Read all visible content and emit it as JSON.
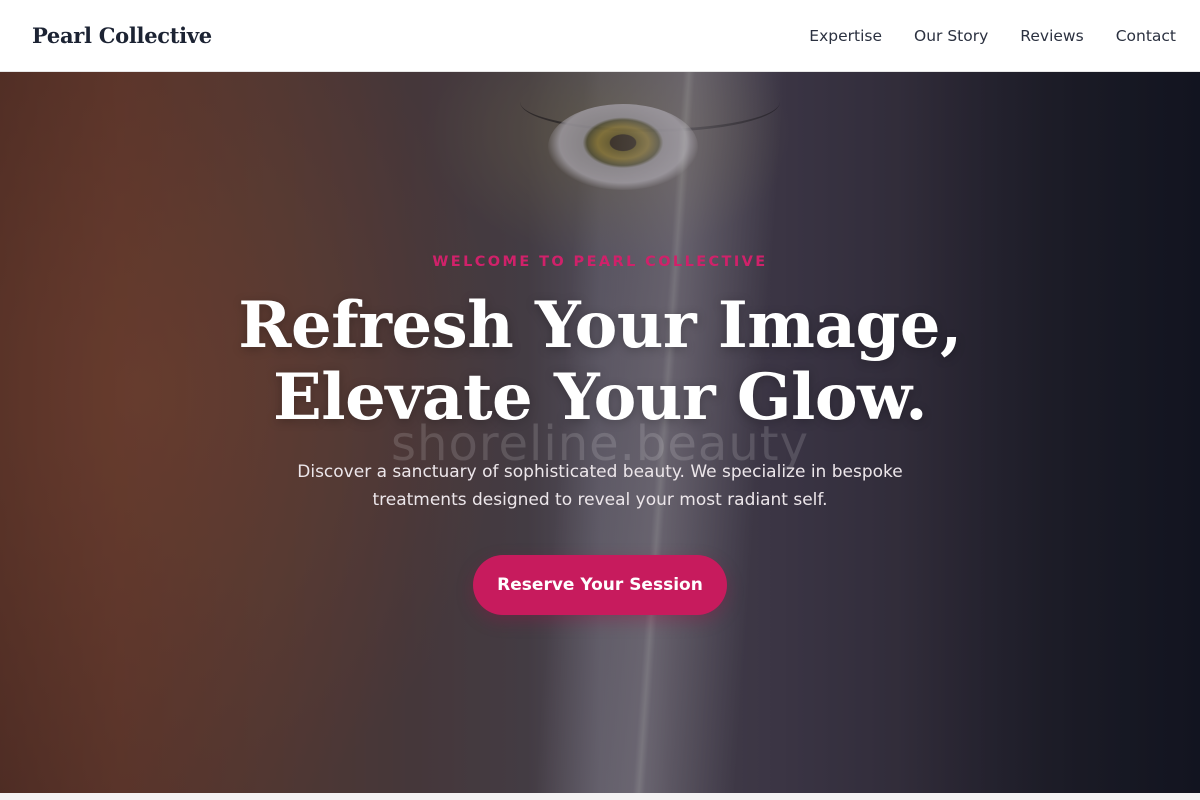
{
  "navbar": {
    "brand": "Pearl Collective",
    "links": [
      {
        "label": "Expertise"
      },
      {
        "label": "Our Story"
      },
      {
        "label": "Reviews"
      },
      {
        "label": "Contact"
      }
    ]
  },
  "hero": {
    "eyebrow": "WELCOME TO PEARL COLLECTIVE",
    "headline_line1": "Refresh Your Image,",
    "headline_line2": "Elevate Your Glow.",
    "watermark": "shoreline.beauty",
    "subtext_line1": "Discover a sanctuary of sophisticated beauty. We specialize in bespoke",
    "subtext_line2": "treatments designed to reveal your most radiant self.",
    "cta_label": "Reserve Your Session",
    "background_image": "close-up portrait of a woman's eye with a beam of light"
  },
  "colors": {
    "accent": "#c71b5d",
    "eyebrow": "#d0216a",
    "brand_text": "#1c2333",
    "nav_text": "#2b3140",
    "hero_text": "#ffffff"
  }
}
